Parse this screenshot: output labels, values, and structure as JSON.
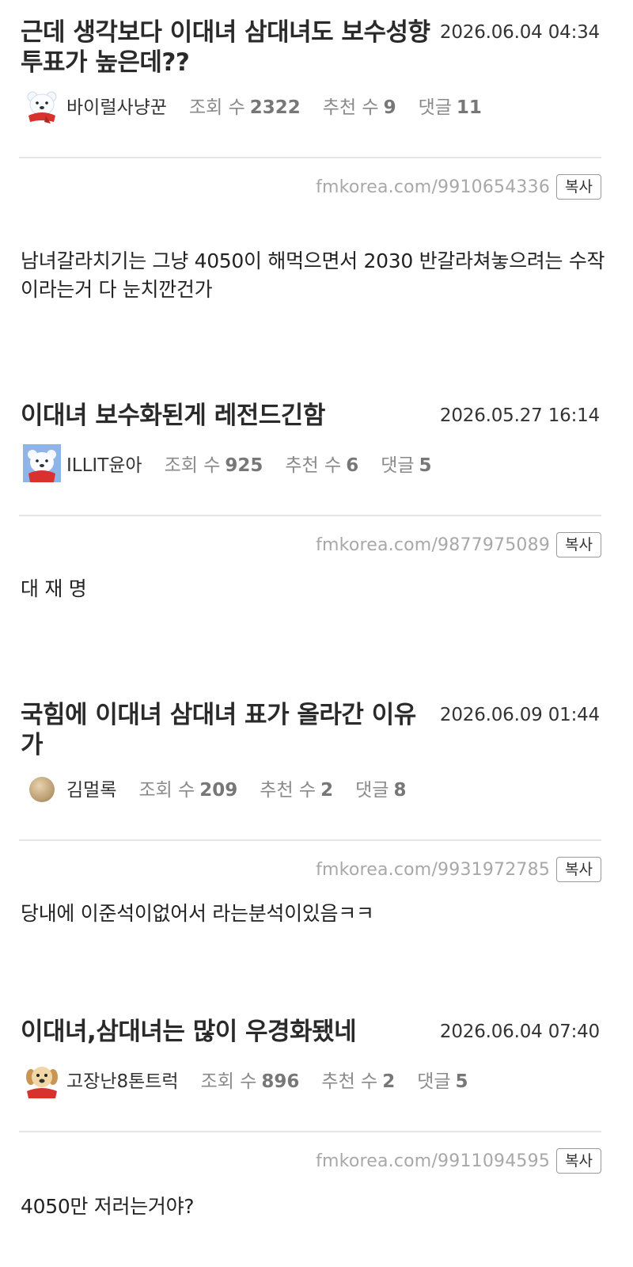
{
  "copy_label": "복사",
  "posts": [
    {
      "title": "근데 생각보다 이대녀 삼대녀도 보수성향 투표가 높은데??",
      "date": "2026.06.04 04:34",
      "nick": "바이럴사냥꾼",
      "avatar": "polar-bear-icon",
      "views_label": "조회 수",
      "views": "2322",
      "likes_label": "추천 수",
      "likes": "9",
      "comments_label": "댓글",
      "comments": "11",
      "url": "fmkorea.com/9910654336",
      "body": "남녀갈라치기는 그냥 4050이 해먹으면서 2030 반갈라쳐놓으려는 수작이라는거 다 눈치깐건가"
    },
    {
      "title": "이대녀 보수화된게 레전드긴함",
      "date": "2026.05.27 16:14",
      "nick": "ILLIT윤아",
      "avatar": "polar-bear-icon",
      "views_label": "조회 수",
      "views": "925",
      "likes_label": "추천 수",
      "likes": "6",
      "comments_label": "댓글",
      "comments": "5",
      "url": "fmkorea.com/9877975089",
      "body": "대 재 명"
    },
    {
      "title": "국힘에 이대녀 삼대녀 표가 올라간 이유가",
      "date": "2026.06.09 01:44",
      "nick": "김멀록",
      "avatar": "ball-icon",
      "views_label": "조회 수",
      "views": "209",
      "likes_label": "추천 수",
      "likes": "2",
      "comments_label": "댓글",
      "comments": "8",
      "url": "fmkorea.com/9931972785",
      "body": "당내에 이준석이없어서 라는분석이있음ㅋㅋ"
    },
    {
      "title": "이대녀,삼대녀는 많이 우경화됐네",
      "date": "2026.06.04 07:40",
      "nick": "고장난8톤트럭",
      "avatar": "puppy-icon",
      "views_label": "조회 수",
      "views": "896",
      "likes_label": "추천 수",
      "likes": "2",
      "comments_label": "댓글",
      "comments": "5",
      "url": "fmkorea.com/9911094595",
      "body": "4050만 저러는거야?"
    }
  ]
}
